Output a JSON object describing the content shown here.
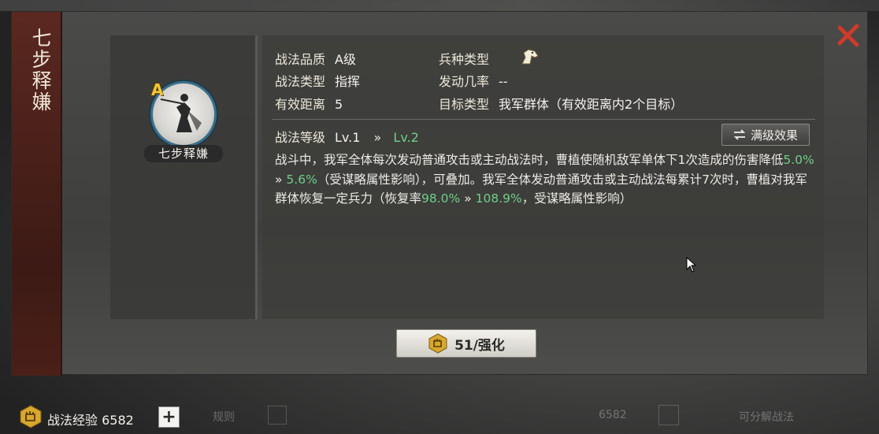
{
  "dialog": {
    "title": "七步释嫌",
    "close_icon": "close-x-icon"
  },
  "portrait": {
    "grade": "A",
    "name": "七步释嫌"
  },
  "info": {
    "quality_label": "战法品质",
    "quality_value": "A级",
    "troop_label": "兵种类型",
    "troop_icon": "cavalry-horse-icon",
    "type_label": "战法类型",
    "type_value": "指挥",
    "trigger_label": "发动几率",
    "trigger_value": "--",
    "range_label": "有效距离",
    "range_value": "5",
    "target_label": "目标类型",
    "target_value": "我军群体（有效距离内2个目标）"
  },
  "level": {
    "label": "战法等级",
    "current": "Lv.1",
    "arrow": "»",
    "next": "Lv.2",
    "max_button_label": "满级效果",
    "max_button_icon": "swap-arrows-icon"
  },
  "description": {
    "p1": "战斗中，我军全体每次发动普通攻击或主动战法时，曹植使随机敌军单体下1次造成的伤害降低",
    "v1_from": "5.0%",
    "arrow": " » ",
    "v1_to": "5.6%",
    "p2": "（受谋略属性影响），可叠加。我军全体发动普通攻击或主动战法每累计7次时，曹植对我军群体恢复一定兵力（恢复率",
    "v2_from": "98.0%",
    "v2_to": "108.9%",
    "p3": "，受谋略属性影响）"
  },
  "enhance": {
    "label": "51/强化",
    "icon": "fist-token-icon"
  },
  "bottom": {
    "exp_label": "战法经验 6582",
    "exp_icon": "fist-token-icon",
    "plus_label": "+",
    "dim_label_1": "规则",
    "dim_value": "6582",
    "dim_action": "可分解战法"
  },
  "colors": {
    "accent_green": "#6fd08a",
    "title_bar": "#5a2820",
    "close_red": "#d03a2a"
  }
}
